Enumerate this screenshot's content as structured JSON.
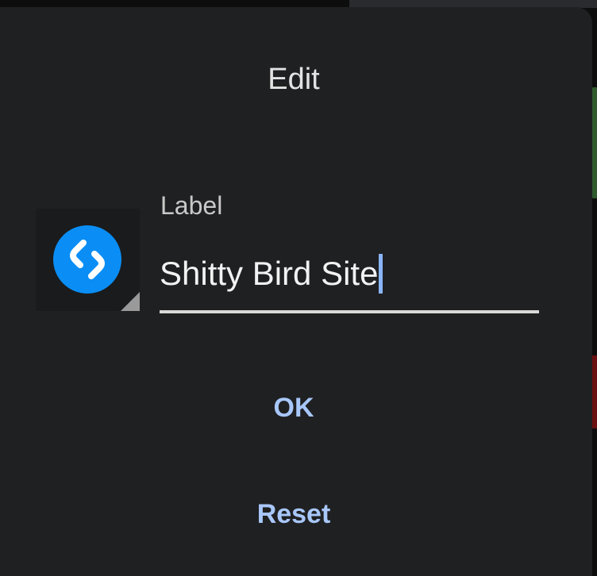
{
  "dialog": {
    "title": "Edit",
    "field": {
      "label": "Label",
      "value": "Shitty Bird Site"
    },
    "buttons": {
      "ok": "OK",
      "reset": "Reset"
    },
    "app_icon": {
      "name": "shazam-icon",
      "color": "#0a8ef5"
    }
  },
  "colors": {
    "dialog_bg": "#1f2022",
    "accent": "#a8c7fa",
    "caret": "#8ab4f8"
  }
}
